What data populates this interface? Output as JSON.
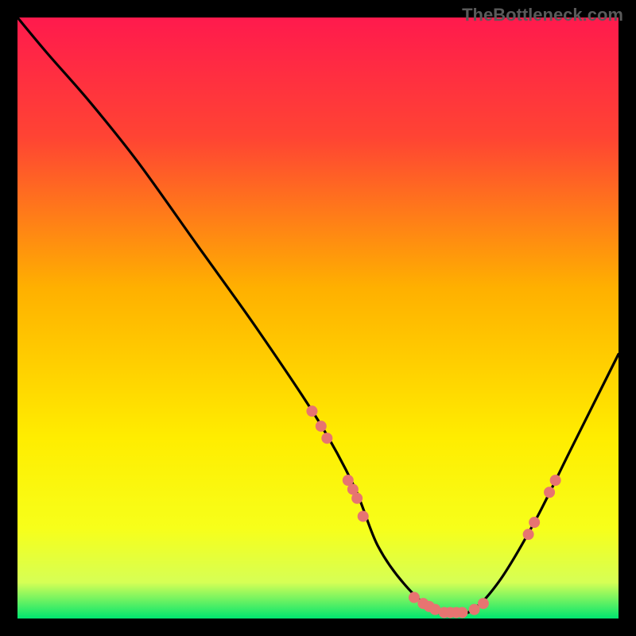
{
  "watermark": "TheBottleneck.com",
  "chart_data": {
    "type": "line",
    "title": "",
    "xlabel": "",
    "ylabel": "",
    "xlim": [
      0,
      100
    ],
    "ylim": [
      0,
      100
    ],
    "gradient_stops": [
      {
        "offset": 0.0,
        "color": "#ff1a4d"
      },
      {
        "offset": 0.2,
        "color": "#ff4433"
      },
      {
        "offset": 0.45,
        "color": "#ffb000"
      },
      {
        "offset": 0.7,
        "color": "#ffed00"
      },
      {
        "offset": 0.85,
        "color": "#f7ff1a"
      },
      {
        "offset": 0.94,
        "color": "#d6ff55"
      },
      {
        "offset": 1.0,
        "color": "#00e56f"
      }
    ],
    "curve": {
      "x": [
        0,
        5,
        12,
        20,
        30,
        40,
        50,
        56,
        60,
        65,
        70,
        75,
        80,
        86,
        92,
        100
      ],
      "y": [
        100,
        94,
        86,
        76,
        62,
        48,
        33,
        22,
        12,
        5,
        1,
        1,
        6,
        16,
        28,
        44
      ]
    },
    "markers": [
      {
        "x": 49.0,
        "y": 34.5
      },
      {
        "x": 50.5,
        "y": 32.0
      },
      {
        "x": 51.5,
        "y": 30.0
      },
      {
        "x": 55.0,
        "y": 23.0
      },
      {
        "x": 55.8,
        "y": 21.5
      },
      {
        "x": 56.5,
        "y": 20.0
      },
      {
        "x": 57.5,
        "y": 17.0
      },
      {
        "x": 66.0,
        "y": 3.5
      },
      {
        "x": 67.5,
        "y": 2.5
      },
      {
        "x": 68.5,
        "y": 2.0
      },
      {
        "x": 69.5,
        "y": 1.5
      },
      {
        "x": 71.0,
        "y": 1.0
      },
      {
        "x": 72.0,
        "y": 1.0
      },
      {
        "x": 73.0,
        "y": 1.0
      },
      {
        "x": 74.0,
        "y": 1.0
      },
      {
        "x": 76.0,
        "y": 1.5
      },
      {
        "x": 77.5,
        "y": 2.5
      },
      {
        "x": 85.0,
        "y": 14.0
      },
      {
        "x": 86.0,
        "y": 16.0
      },
      {
        "x": 88.5,
        "y": 21.0
      },
      {
        "x": 89.5,
        "y": 23.0
      }
    ],
    "marker_style": {
      "fill": "#e77471",
      "radius_px": 7
    }
  }
}
